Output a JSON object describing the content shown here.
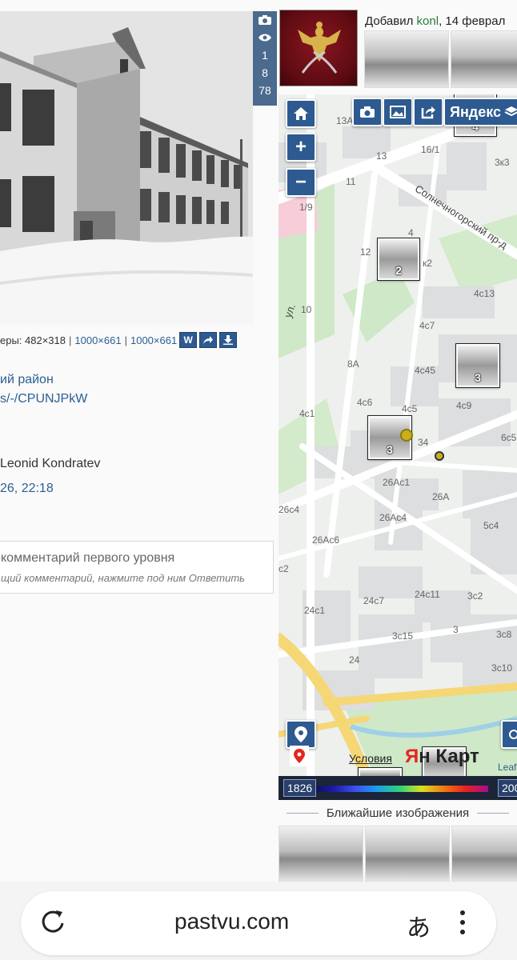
{
  "photo": {
    "stats": [
      "1",
      "8",
      "78"
    ],
    "dims_prefix": "еры: 482×318",
    "link1": "1000×661",
    "link2": "1000×661",
    "sep": "|",
    "buttons": {
      "w": "W"
    }
  },
  "info": {
    "region_link": "ий район",
    "short_link": "s/-/CPUNJPkW",
    "author": "Leonid Kondratev",
    "date_link": "26, 22:18"
  },
  "comment": {
    "placeholder": "комментарий первого уровня",
    "hint": "щий комментарий, нажмите под ним Ответить"
  },
  "header": {
    "added_prefix": "Добавил ",
    "user": "konl",
    "added_suffix": ", 14 феврал"
  },
  "map": {
    "layer_button": "Яндекс",
    "zoom_in": "+",
    "zoom_out": "−",
    "street": "Солнечногорский пр-д",
    "street2": "ул.",
    "labels": [
      "13А",
      "13",
      "16/1",
      "3к3",
      "11",
      "1/9",
      "4",
      "12",
      "к2",
      "4с13",
      "10",
      "4с7",
      "8А",
      "4с45",
      "4с6",
      "4с5",
      "4с9",
      "4с1",
      "34",
      "6с5",
      "26Ас1",
      "26А",
      "26с4",
      "26Ас4",
      "5с4",
      "26Ас6",
      "с2",
      "24с7",
      "24с11",
      "3с2",
      "24с1",
      "3",
      "3с15",
      "3с8",
      "24",
      "3с10"
    ],
    "markers": [
      "4",
      "2",
      "3",
      "3"
    ],
    "terms": "Условия",
    "provider_y": "Я",
    "provider_rest": "н   Карт",
    "leaflet": "Leaf"
  },
  "timeline": {
    "start": "1826",
    "end": "200"
  },
  "nearby": {
    "title": "Ближайшие изображения"
  },
  "browser": {
    "url": "pastvu.com",
    "translate": "あ"
  },
  "colors": {
    "accent": "#2d5a90",
    "link": "#2a5f92",
    "user": "#2a7a3a"
  }
}
